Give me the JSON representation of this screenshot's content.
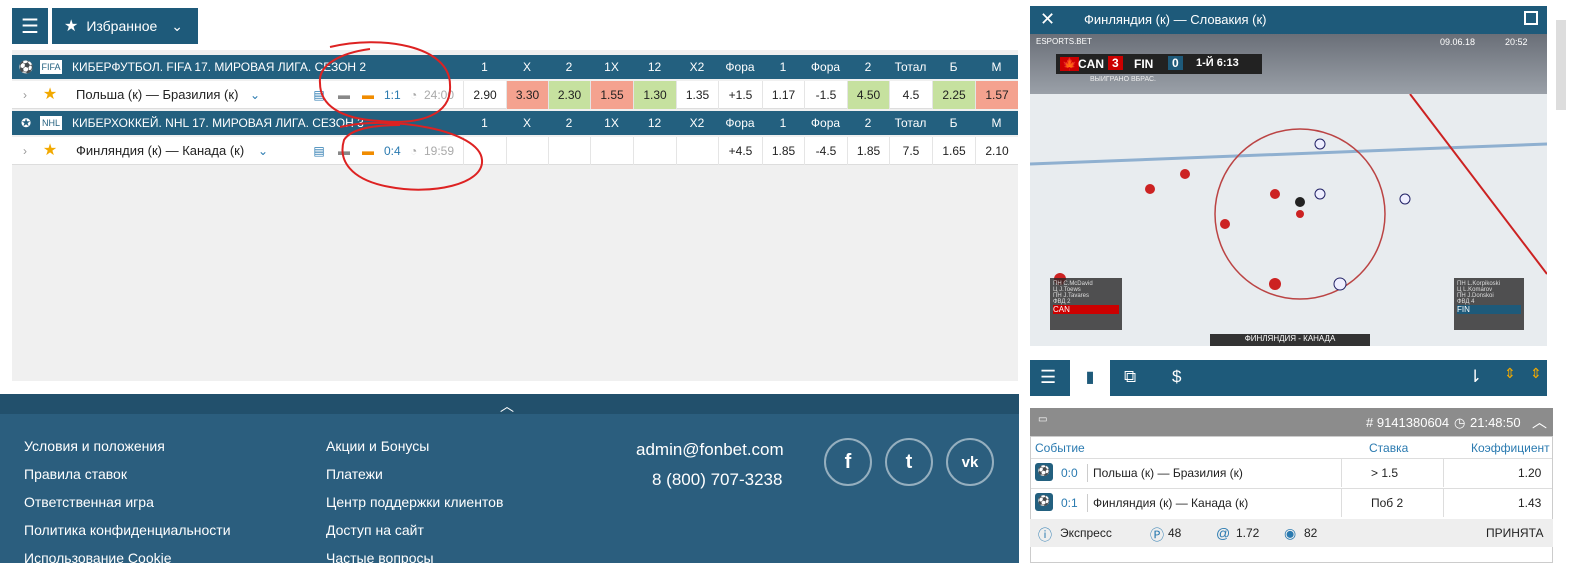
{
  "topbar": {
    "favorites_label": "Избранное"
  },
  "leagues": [
    {
      "icon": "FIFA",
      "title": "КИБЕРФУТБОЛ. FIFA 17. МИРОВАЯ ЛИГА. СЕЗОН 2",
      "headers": [
        "1",
        "X",
        "2",
        "1X",
        "12",
        "X2",
        "Фора",
        "1",
        "Фора",
        "2",
        "Тотал",
        "Б",
        "М"
      ],
      "event": {
        "name": "Польша (к) — Бразилия (к)",
        "score": "1:1",
        "time": "24:00",
        "odds": [
          "2.90",
          "3.30",
          "2.30",
          "1.55",
          "1.30",
          "1.35",
          "+1.5",
          "1.17",
          "-1.5",
          "4.50",
          "4.5",
          "2.25",
          "1.57"
        ]
      }
    },
    {
      "icon": "NHL",
      "title": "КИБЕРХОККЕЙ. NHL 17. МИРОВАЯ ЛИГА. СЕЗОН 3",
      "headers": [
        "1",
        "X",
        "2",
        "1X",
        "12",
        "X2",
        "Фора",
        "1",
        "Фора",
        "2",
        "Тотал",
        "Б",
        "М"
      ],
      "event": {
        "name": "Финляндия (к) — Канада (к)",
        "score": "0:4",
        "time": "19:59",
        "odds": [
          "",
          "",
          "",
          "",
          "",
          "",
          "+4.5",
          "1.85",
          "-4.5",
          "1.85",
          "7.5",
          "1.65",
          "2.10"
        ]
      }
    }
  ],
  "footer": {
    "col1": [
      "Условия и положения",
      "Правила ставок",
      "Ответственная игра",
      "Политика конфиденциальности",
      "Использование Cookie"
    ],
    "col2": [
      "Акции и Бонусы",
      "Платежи",
      "Центр поддержки клиентов",
      "Доступ на сайт",
      "Частые вопросы"
    ],
    "email": "admin@fonbet.com",
    "phone": "8 (800) 707-3238",
    "social": [
      "f",
      "t",
      "vk"
    ]
  },
  "video": {
    "title": "Финляндия (к) — Словакия (к)",
    "date": "09.06.18",
    "clock": "20:52",
    "score": {
      "home": "CAN",
      "home_score": "3",
      "away": "FIN",
      "away_score": "0",
      "period": "1-Й 6:13"
    },
    "sub": "ВЫИГРАНО ВБРАС.",
    "caption": "ФИНЛЯНДИЯ - КАНАДА",
    "left_box": {
      "team": "CAN",
      "players": [
        "ПН C.McDavid",
        "Ц J.Toews",
        "ПН J.Tavares"
      ],
      "label": "ФВД 2"
    },
    "right_box": {
      "team": "FIN",
      "players": [
        "ПН L.Korpikoski",
        "Ц L.Komarov",
        "ПН J.Donskoi"
      ],
      "label": "ФВД 4"
    },
    "brand": "ESPORTS.BET"
  },
  "slip": {
    "id": "# 9141380604",
    "time": "21:48:50",
    "headers": [
      "Событие",
      "Ставка",
      "Коэффициент"
    ],
    "rows": [
      {
        "score": "0:0",
        "event": "Польша (к) — Бразилия (к)",
        "bet": "> 1.5",
        "coef": "1.20"
      },
      {
        "score": "0:1",
        "event": "Финляндия (к) — Канада (к)",
        "bet": "Поб 2",
        "coef": "1.43"
      }
    ],
    "type": "Экспресс",
    "p": "48",
    "at": "1.72",
    "c": "82",
    "status": "ПРИНЯТА"
  }
}
